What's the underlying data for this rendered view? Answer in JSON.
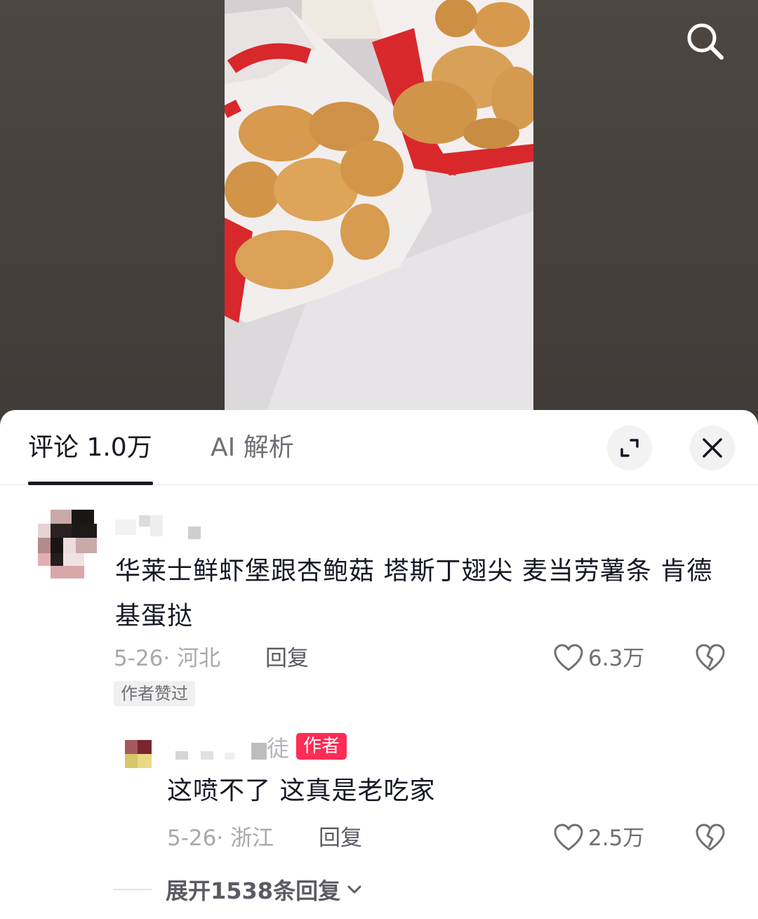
{
  "video": {
    "search_icon": "search-icon",
    "brand_colors": {
      "bag_red": "#d8282c",
      "bag_white": "#f4efec",
      "nugget": "#d79a4e"
    }
  },
  "comments_panel": {
    "tabs": [
      {
        "label": "评论 1.0万",
        "active": true
      },
      {
        "label": "AI 解析",
        "active": false
      }
    ],
    "expand_icon": "expand-icon",
    "close_icon": "close-icon"
  },
  "comment": {
    "text": "华莱士鲜虾堡跟杏鲍菇  塔斯丁翅尖 麦当劳薯条 肯德基蛋挞",
    "date_location": "5-26· 河北",
    "reply_label": "回复",
    "likes": "6.3万",
    "author_liked_badge": "作者赞过"
  },
  "reply": {
    "name_fragment": "徒",
    "author_badge": "作者",
    "text": "这喷不了 这真是老吃家",
    "date_location": "5-26· 浙江",
    "reply_label": "回复",
    "likes": "2.5万"
  },
  "expand_replies": {
    "label": "展开1538条回复"
  },
  "colors": {
    "accent": "#fe2c55",
    "text_primary": "#161823",
    "text_secondary": "#a8a8ad"
  }
}
